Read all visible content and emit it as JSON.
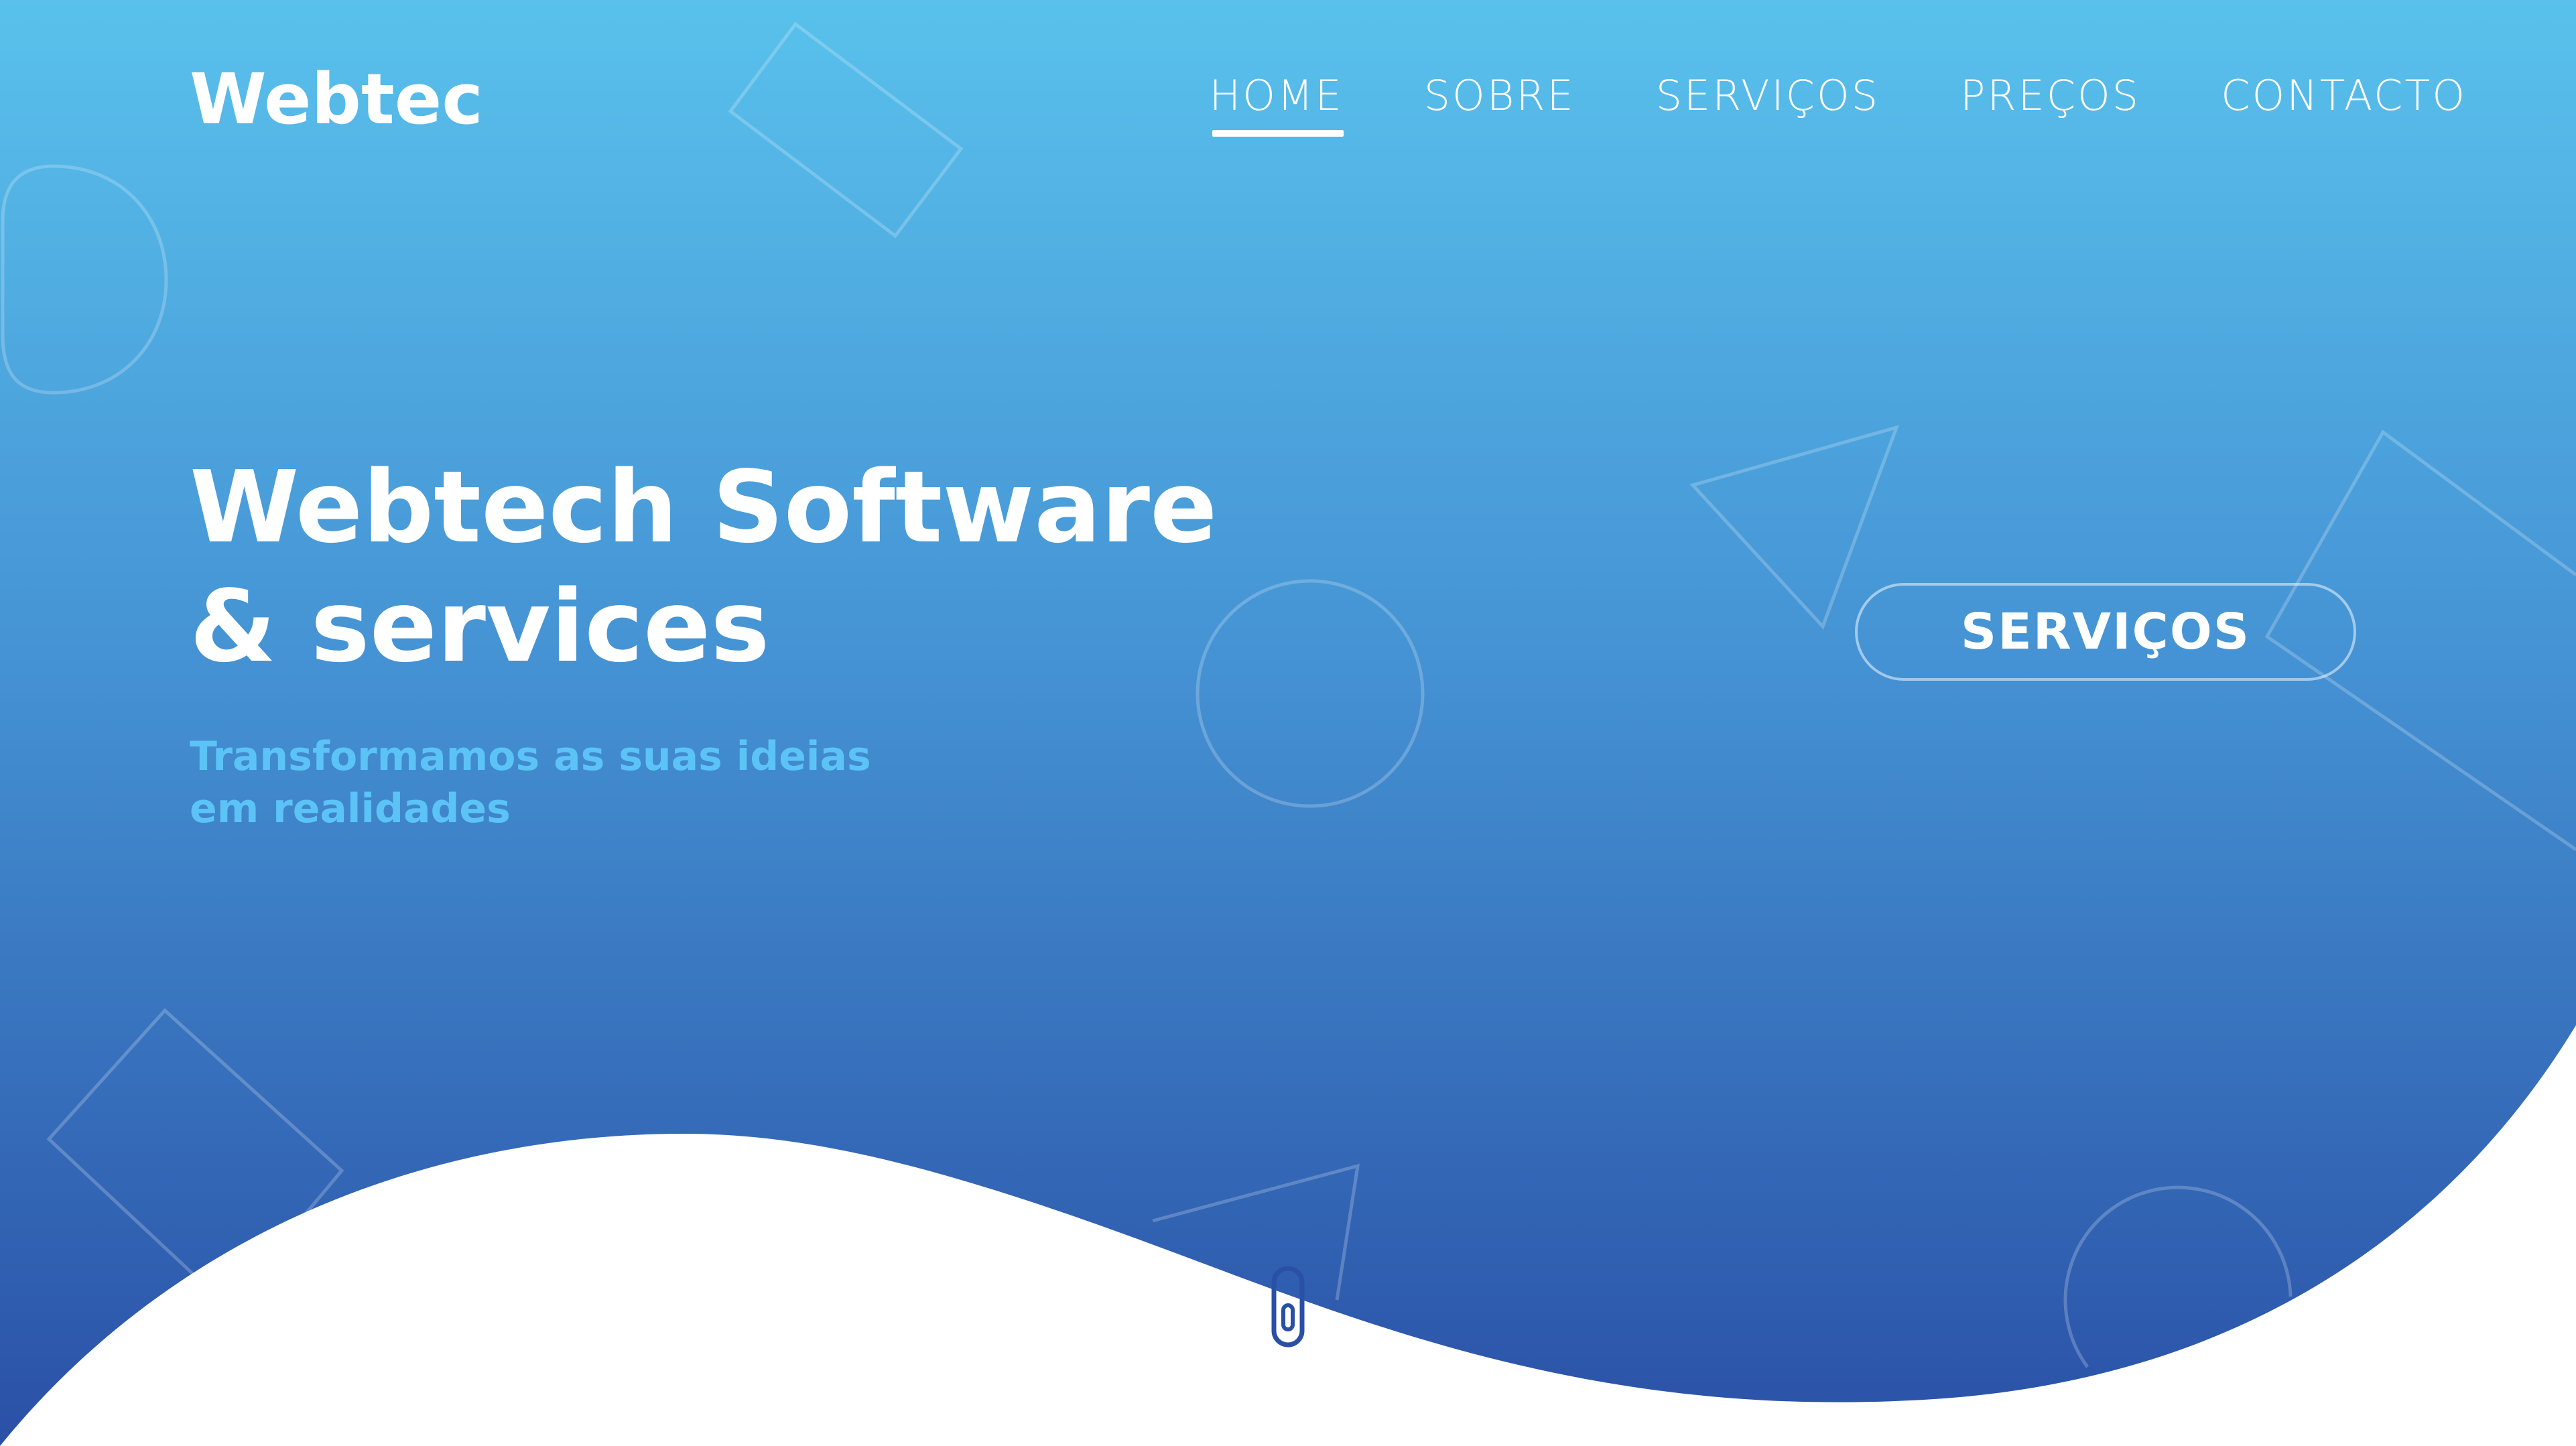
{
  "header": {
    "logo": "Webtec",
    "nav": [
      {
        "label": "HOME",
        "active": true
      },
      {
        "label": "SOBRE",
        "active": false
      },
      {
        "label": "SERVIÇOS",
        "active": false
      },
      {
        "label": "PREÇOS",
        "active": false
      },
      {
        "label": "CONTACTO",
        "active": false
      }
    ]
  },
  "hero": {
    "title_line1": "Webtech Software",
    "title_line2": "& services",
    "subtitle_line1": "Transformamos as suas ideias",
    "subtitle_line2": "em realidades",
    "cta_label": "SERVIÇOS"
  },
  "theme": {
    "gradient_top": "#59c1ec",
    "gradient_bottom": "#2a50a6",
    "subtitle_color": "#5cc3f7",
    "text_color": "#ffffff"
  },
  "decor": {
    "shapes": [
      "rectangle-outline",
      "semicircle-outline",
      "triangle-outline",
      "circle-outline",
      "diamond-outline"
    ],
    "scroll_icon": "mouse-scroll-icon"
  }
}
